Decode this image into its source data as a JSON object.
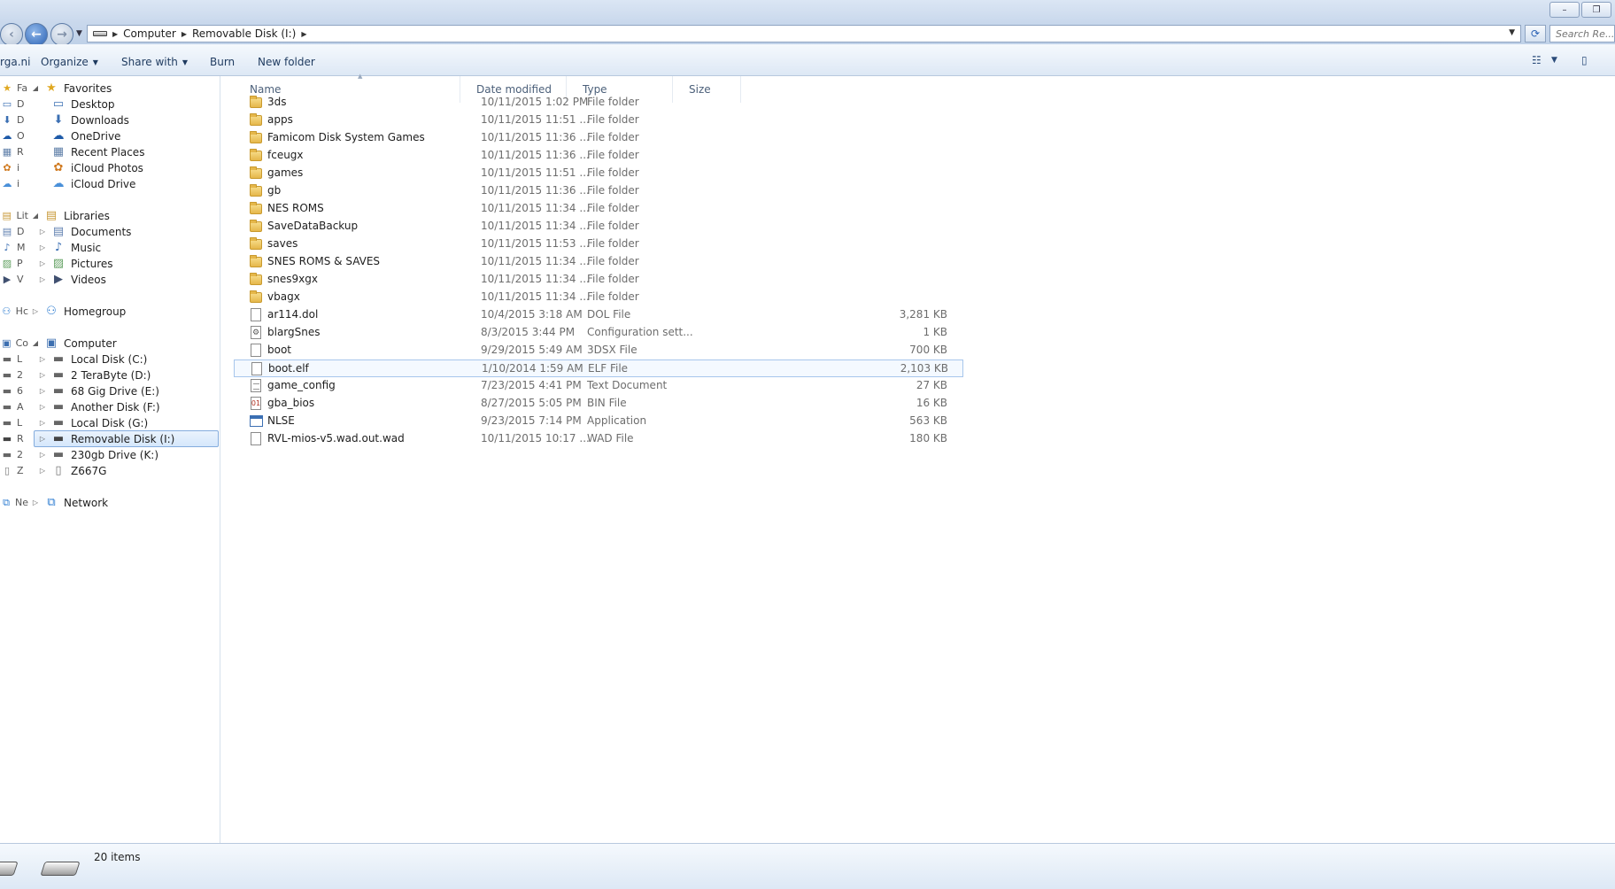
{
  "window": {
    "minimize": "–",
    "maximize": "❐"
  },
  "address": {
    "crumbs": [
      "Computer",
      "Removable Disk (I:)"
    ],
    "search_placeholder": "Search Re..."
  },
  "toolbar": {
    "ghost_label": "rga.ni",
    "organize": "Organize",
    "share_with": "Share with",
    "burn": "Burn",
    "new_folder": "New folder"
  },
  "ghost_nav": [
    "Fa",
    "D",
    "D",
    "O",
    "R",
    "i",
    "i",
    "Lit",
    "D",
    "M",
    "P",
    "V",
    "Hc",
    "Co",
    "L",
    "2",
    "6",
    "A",
    "L",
    "R",
    "2",
    "Z",
    "Ne"
  ],
  "navpane": {
    "favorites": {
      "label": "Favorites",
      "items": [
        "Desktop",
        "Downloads",
        "OneDrive",
        "Recent Places",
        "iCloud Photos",
        "iCloud Drive"
      ]
    },
    "libraries": {
      "label": "Libraries",
      "items": [
        "Documents",
        "Music",
        "Pictures",
        "Videos"
      ]
    },
    "homegroup": "Homegroup",
    "computer": {
      "label": "Computer",
      "items": [
        "Local Disk (C:)",
        "2 TeraByte (D:)",
        "68 Gig Drive (E:)",
        "Another Disk (F:)",
        "Local Disk (G:)",
        "Removable Disk (I:)",
        "230gb Drive (K:)",
        "Z667G"
      ]
    },
    "network": "Network"
  },
  "columns": {
    "name": "Name",
    "date": "Date modified",
    "type": "Type",
    "size": "Size"
  },
  "files": [
    {
      "name": "3ds",
      "date": "10/11/2015 1:02 PM",
      "type": "File folder",
      "size": "",
      "icon": "folder-icon"
    },
    {
      "name": "apps",
      "date": "10/11/2015 11:51 ...",
      "type": "File folder",
      "size": "",
      "icon": "folder-icon"
    },
    {
      "name": "Famicom Disk System Games",
      "date": "10/11/2015 11:36 ...",
      "type": "File folder",
      "size": "",
      "icon": "folder-icon"
    },
    {
      "name": "fceugx",
      "date": "10/11/2015 11:36 ...",
      "type": "File folder",
      "size": "",
      "icon": "folder-icon"
    },
    {
      "name": "games",
      "date": "10/11/2015 11:51 ...",
      "type": "File folder",
      "size": "",
      "icon": "folder-icon"
    },
    {
      "name": "gb",
      "date": "10/11/2015 11:36 ...",
      "type": "File folder",
      "size": "",
      "icon": "folder-icon"
    },
    {
      "name": "NES ROMS",
      "date": "10/11/2015 11:34 ...",
      "type": "File folder",
      "size": "",
      "icon": "folder-icon"
    },
    {
      "name": "SaveDataBackup",
      "date": "10/11/2015 11:34 ...",
      "type": "File folder",
      "size": "",
      "icon": "folder-icon"
    },
    {
      "name": "saves",
      "date": "10/11/2015 11:53 ...",
      "type": "File folder",
      "size": "",
      "icon": "folder-icon"
    },
    {
      "name": "SNES ROMS & SAVES",
      "date": "10/11/2015 11:34 ...",
      "type": "File folder",
      "size": "",
      "icon": "folder-icon"
    },
    {
      "name": "snes9xgx",
      "date": "10/11/2015 11:34 ...",
      "type": "File folder",
      "size": "",
      "icon": "folder-icon"
    },
    {
      "name": "vbagx",
      "date": "10/11/2015 11:34 ...",
      "type": "File folder",
      "size": "",
      "icon": "folder-icon"
    },
    {
      "name": "ar114.dol",
      "date": "10/4/2015 3:18 AM",
      "type": "DOL File",
      "size": "3,281 KB",
      "icon": "doc-icon"
    },
    {
      "name": "blargSnes",
      "date": "8/3/2015 3:44 PM",
      "type": "Configuration sett...",
      "size": "1 KB",
      "icon": "cfg-icon"
    },
    {
      "name": "boot",
      "date": "9/29/2015 5:49 AM",
      "type": "3DSX File",
      "size": "700 KB",
      "icon": "doc-icon"
    },
    {
      "name": "boot.elf",
      "date": "1/10/2014 1:59 AM",
      "type": "ELF File",
      "size": "2,103 KB",
      "icon": "doc-icon"
    },
    {
      "name": "game_config",
      "date": "7/23/2015 4:41 PM",
      "type": "Text Document",
      "size": "27 KB",
      "icon": "txt-icon"
    },
    {
      "name": "gba_bios",
      "date": "8/27/2015 5:05 PM",
      "type": "BIN File",
      "size": "16 KB",
      "icon": "bin-icon"
    },
    {
      "name": "NLSE",
      "date": "9/23/2015 7:14 PM",
      "type": "Application",
      "size": "563 KB",
      "icon": "app-icon"
    },
    {
      "name": "RVL-mios-v5.wad.out.wad",
      "date": "10/11/2015 10:17 ...",
      "type": "WAD File",
      "size": "180 KB",
      "icon": "doc-icon"
    }
  ],
  "selected_file_index": 15,
  "status": {
    "item_count": "20 items"
  },
  "colors": {
    "accent": "#2b62b4",
    "selection_border": "#84acdd",
    "link_text": "#1e3a5f"
  }
}
